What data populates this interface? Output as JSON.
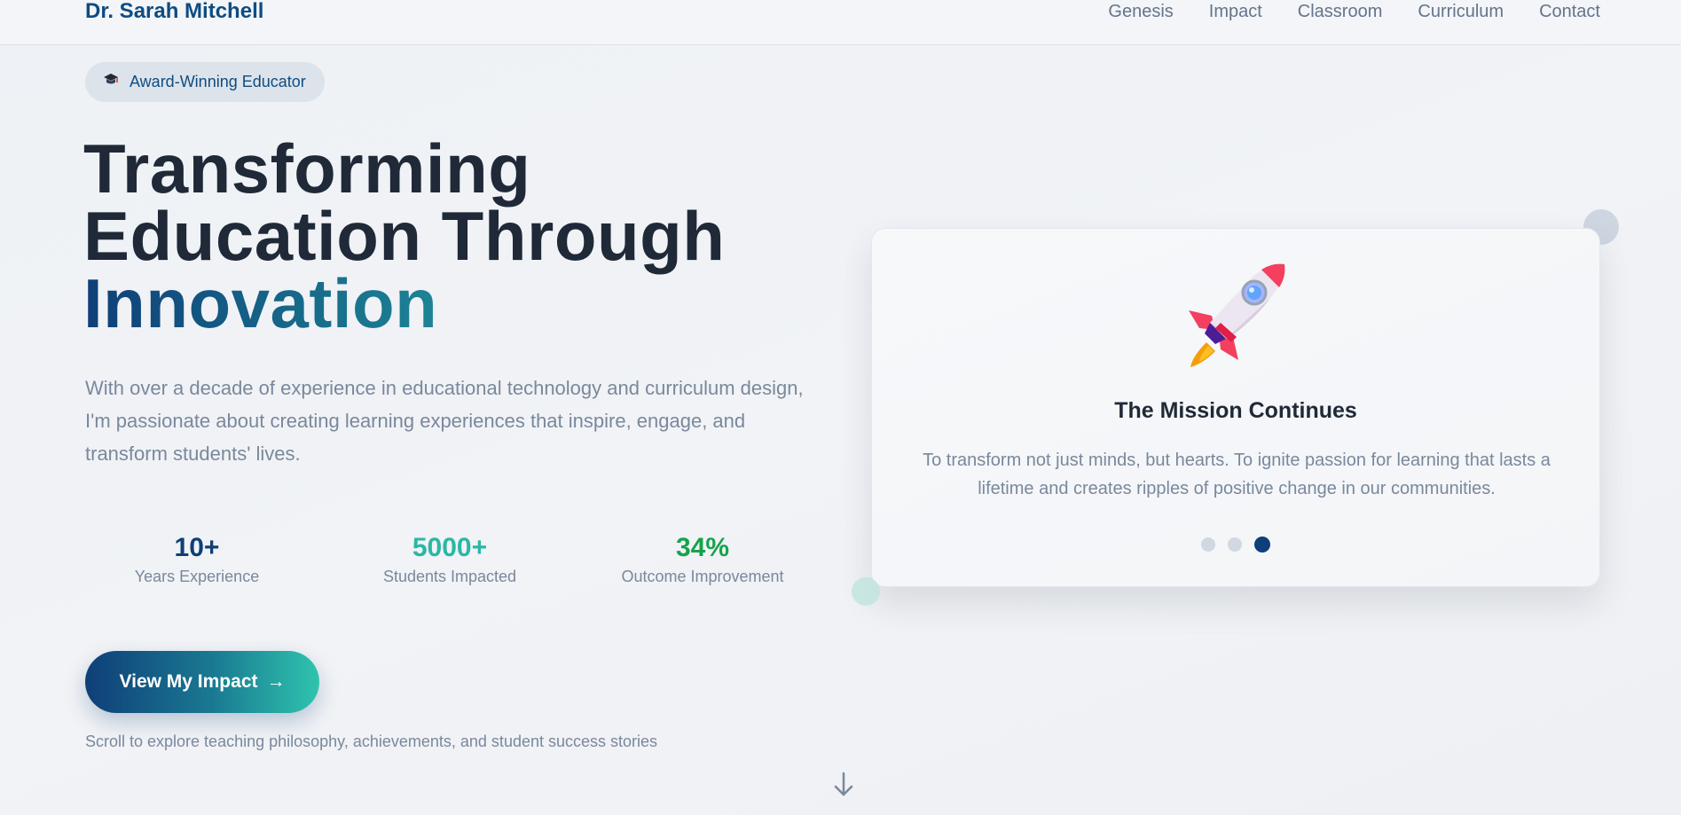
{
  "header": {
    "brand": "Dr. Sarah Mitchell",
    "nav": [
      "Genesis",
      "Impact",
      "Classroom",
      "Curriculum",
      "Contact"
    ]
  },
  "badge": {
    "icon": "graduation-cap-icon",
    "label": "Award-Winning Educator"
  },
  "hero": {
    "headline_line1": "Transforming",
    "headline_line2": "Education Through",
    "headline_accent": "Innovation",
    "intro": "With over a decade of experience in educational technology and curriculum design, I'm passionate about creating learning experiences that inspire, engage, and transform students' lives."
  },
  "stats": [
    {
      "value": "10+",
      "label": "Years Experience",
      "color": "#0f3f78"
    },
    {
      "value": "5000+",
      "label": "Students Impacted",
      "color": "#2bb7a4"
    },
    {
      "value": "34%",
      "label": "Outcome Improvement",
      "color": "#16a34a"
    }
  ],
  "cta": {
    "label": "View My Impact",
    "arrow": "→"
  },
  "scroll_note": "Scroll to explore teaching philosophy, achievements, and student success stories",
  "card": {
    "icon": "rocket-icon",
    "title": "The Mission Continues",
    "text": "To transform not just minds, but hearts. To ignite passion for learning that lasts a lifetime and creates ripples of positive change in our communities.",
    "slides_total": 3,
    "active_slide": 3
  },
  "colors": {
    "brand": "#0f4c81",
    "accent_start": "#0f3f78",
    "accent_end": "#2ec4ae"
  }
}
